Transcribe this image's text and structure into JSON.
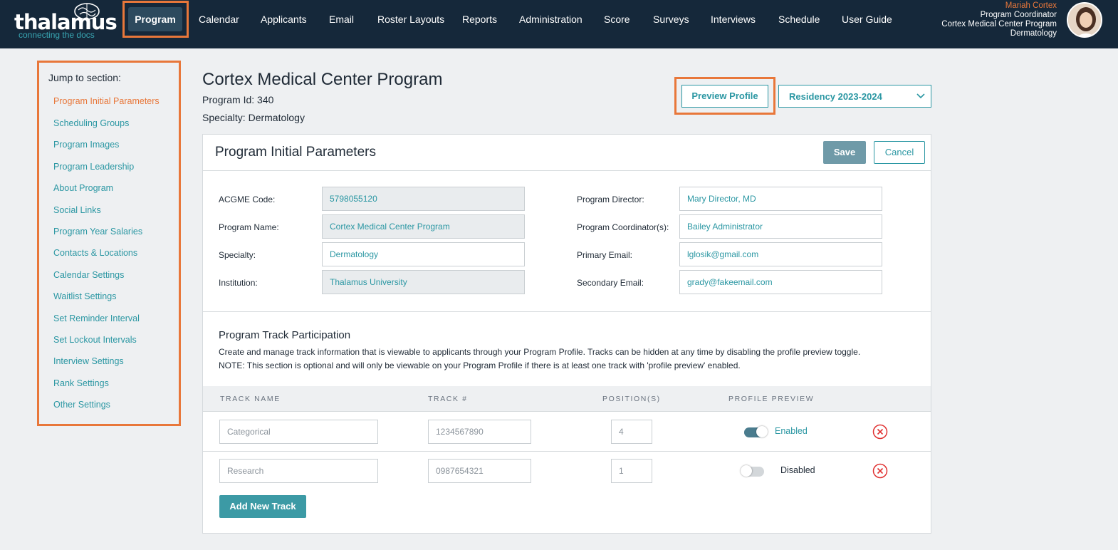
{
  "app": {
    "logo_text": "thalamus",
    "logo_tagline": "connecting the docs"
  },
  "nav": {
    "items": [
      "Program",
      "Calendar",
      "Applicants",
      "Email",
      "Roster Layouts",
      "Reports",
      "Administration",
      "Score",
      "Surveys",
      "Interviews",
      "Schedule",
      "User Guide"
    ],
    "active": "Program"
  },
  "user": {
    "name": "Mariah Cortex",
    "role": "Program Coordinator",
    "program": "Cortex Medical Center Program",
    "specialty": "Dermatology"
  },
  "sidebar": {
    "title": "Jump to section:",
    "items": [
      {
        "label": "Program Initial Parameters",
        "active": true
      },
      {
        "label": "Scheduling Groups"
      },
      {
        "label": "Program Images"
      },
      {
        "label": "Program Leadership"
      },
      {
        "label": "About Program"
      },
      {
        "label": "Social Links"
      },
      {
        "label": "Program Year Salaries"
      },
      {
        "label": "Contacts & Locations"
      },
      {
        "label": "Calendar Settings"
      },
      {
        "label": "Waitlist Settings"
      },
      {
        "label": "Set Reminder Interval"
      },
      {
        "label": "Set Lockout Intervals"
      },
      {
        "label": "Interview Settings"
      },
      {
        "label": "Rank Settings"
      },
      {
        "label": "Other Settings"
      }
    ]
  },
  "header": {
    "title": "Cortex Medical Center Program",
    "program_id": "Program Id: 340",
    "specialty": "Specialty: Dermatology",
    "preview_button": "Preview Profile",
    "year_select": "Residency 2023-2024"
  },
  "card": {
    "title": "Program Initial Parameters",
    "save": "Save",
    "cancel": "Cancel",
    "fields_left": [
      {
        "label": "ACGME Code:",
        "value": "5798055120",
        "readonly": true
      },
      {
        "label": "Program Name:",
        "value": "Cortex Medical Center Program",
        "readonly": true
      },
      {
        "label": "Specialty:",
        "value": "Dermatology",
        "readonly": false
      },
      {
        "label": "Institution:",
        "value": "Thalamus University",
        "readonly": true
      }
    ],
    "fields_right": [
      {
        "label": "Program Director:",
        "value": "Mary Director, MD"
      },
      {
        "label": "Program Coordinator(s):",
        "value": "Bailey Administrator"
      },
      {
        "label": "Primary Email:",
        "value": "lglosik@gmail.com"
      },
      {
        "label": "Secondary Email:",
        "value": "grady@fakeemail.com"
      }
    ]
  },
  "tracks": {
    "title": "Program Track Participation",
    "desc_line1": "Create and manage track information that is viewable to applicants through your Program Profile. Tracks can be hidden at any time by disabling the profile preview toggle.",
    "desc_line2": "NOTE: This section is optional and will only be viewable on your Program Profile if there is at least one track with 'profile preview' enabled.",
    "columns": [
      "TRACK NAME",
      "TRACK #",
      "POSITION(S)",
      "PROFILE PREVIEW"
    ],
    "rows": [
      {
        "name": "Categorical",
        "number": "1234567890",
        "positions": "4",
        "preview": "Enabled",
        "enabled": true
      },
      {
        "name": "Research",
        "number": "0987654321",
        "positions": "1",
        "preview": "Disabled",
        "enabled": false
      }
    ],
    "add_button": "Add New Track"
  },
  "colors": {
    "accent_orange": "#e8773a",
    "teal": "#2b97a3",
    "nav_bg": "#15283a"
  }
}
